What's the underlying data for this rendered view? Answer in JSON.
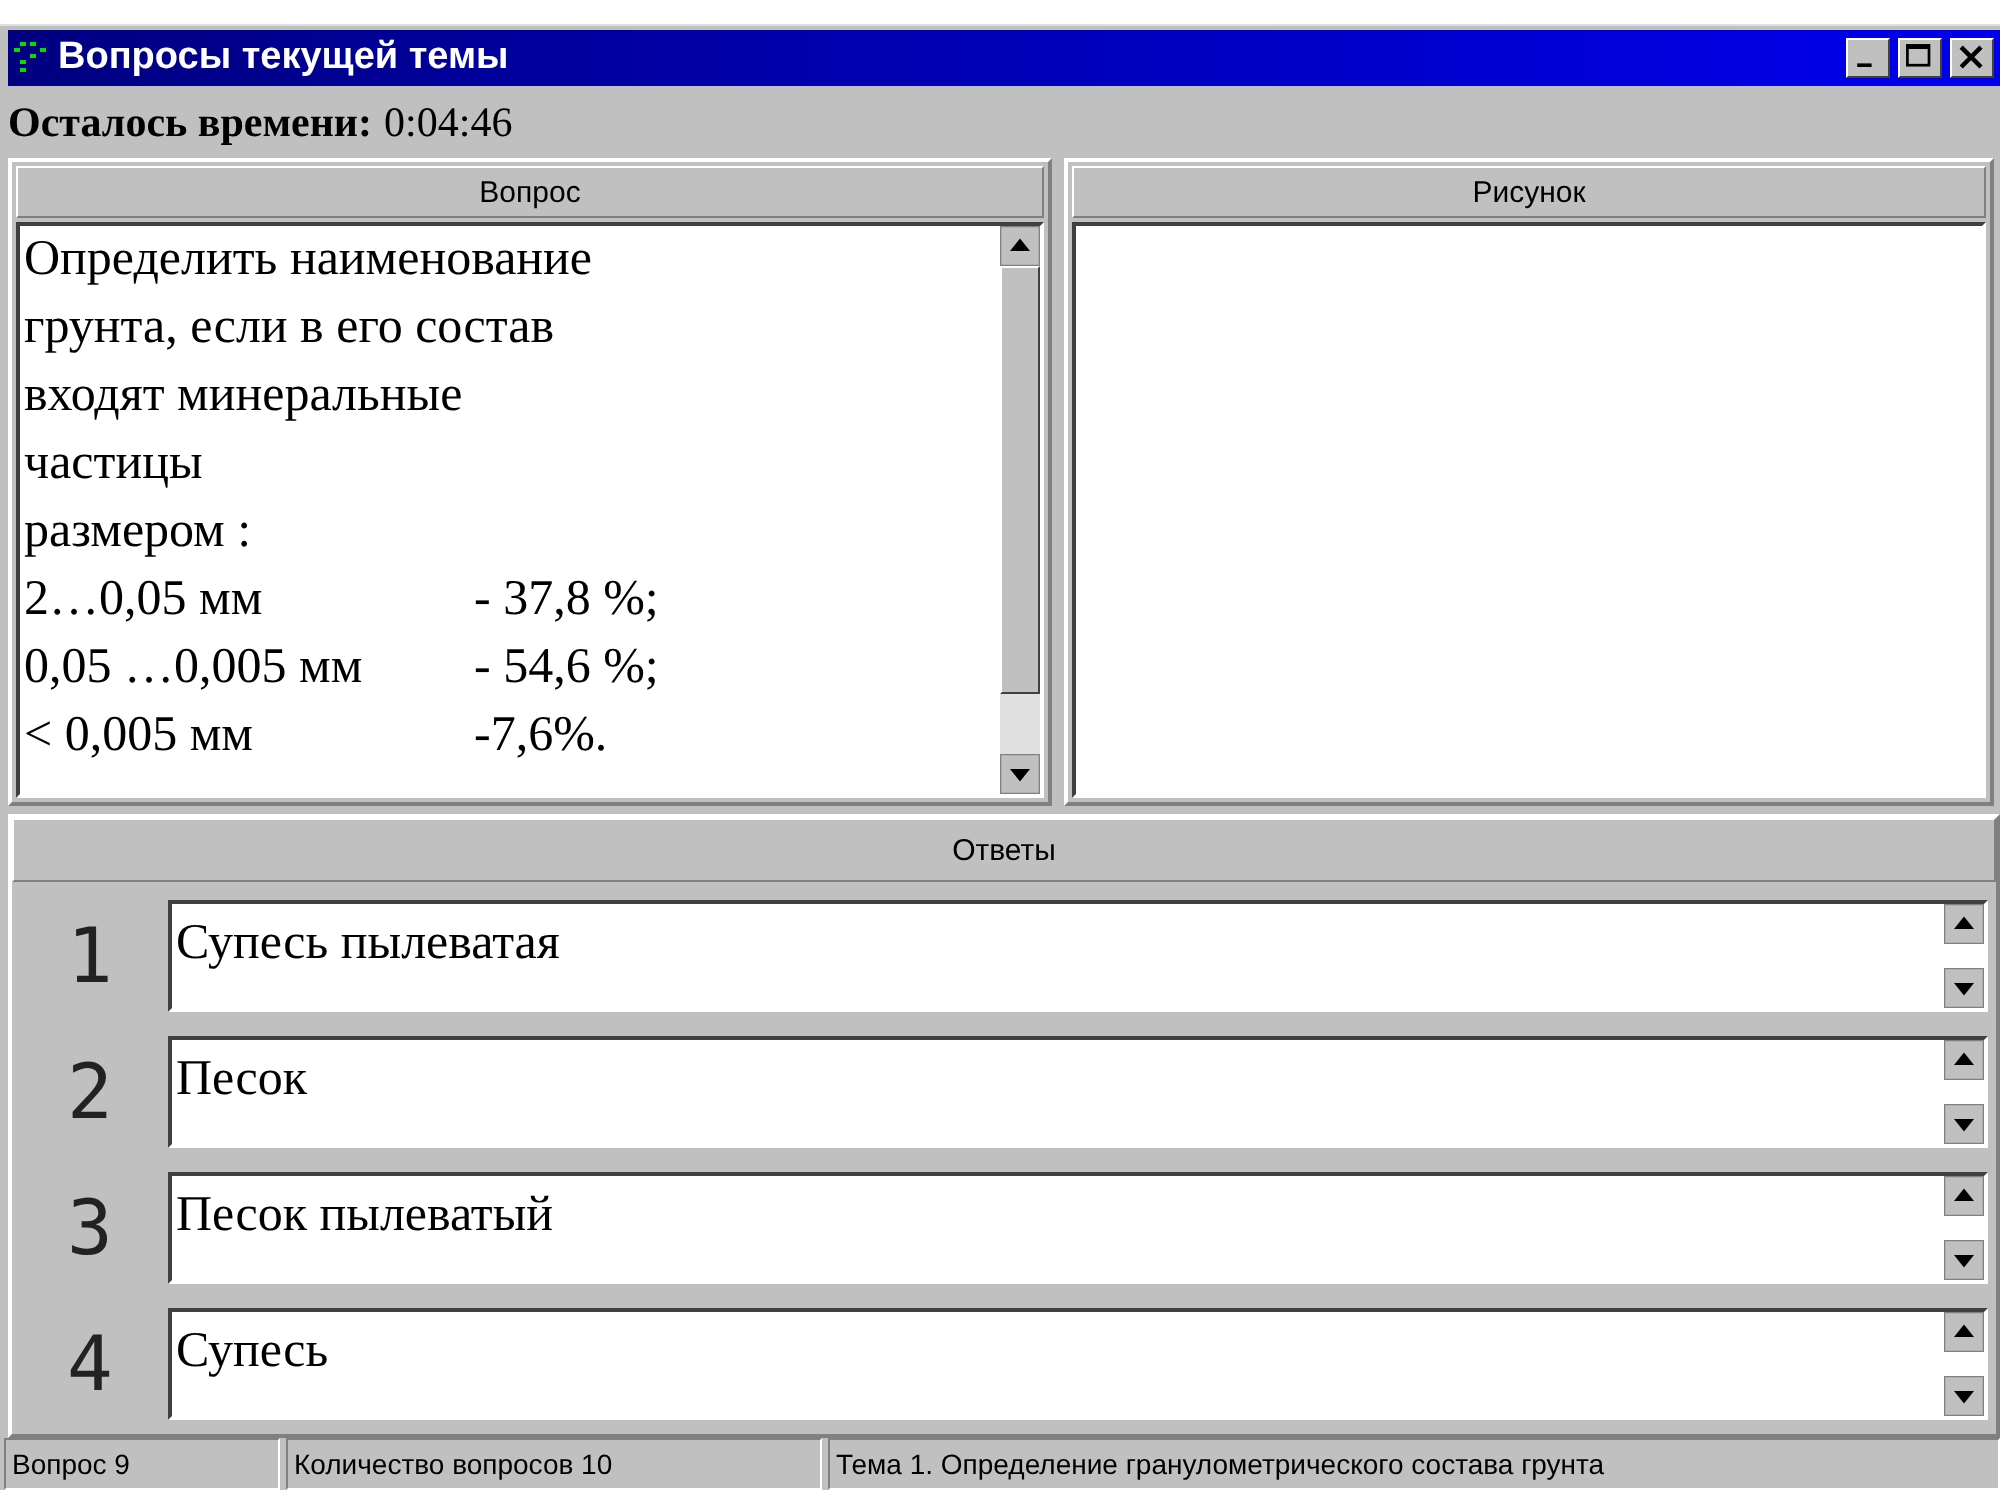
{
  "window": {
    "title": "Вопросы текущей темы"
  },
  "timer": {
    "label": "Осталось времени:",
    "value": "0:04:46"
  },
  "question": {
    "header": "Вопрос",
    "lines": [
      {
        "text": "Определить наименование"
      },
      {
        "text": "грунта, если в его состав"
      },
      {
        "text": "входят минеральные"
      },
      {
        "text": "частицы"
      },
      {
        "text": "размером :"
      },
      {
        "text": "2…0,05 мм",
        "share": "- 37,8 %;"
      },
      {
        "text": "0,05 …0,005 мм",
        "share": "- 54,6 %;"
      },
      {
        "text": "< 0,005 мм",
        "share": "-7,6%."
      }
    ]
  },
  "picture": {
    "header": "Рисунок"
  },
  "answers": {
    "header": "Ответы",
    "items": [
      {
        "number": "1",
        "text": "Супесь пылеватая"
      },
      {
        "number": "2",
        "text": "Песок"
      },
      {
        "number": "3",
        "text": "Песок пылеватый"
      },
      {
        "number": "4",
        "text": "Супесь"
      }
    ]
  },
  "status_bar": [
    "Вопрос 9",
    "Количество вопросов 10",
    "Тема 1. Определение гранулометрического состава грунта"
  ]
}
